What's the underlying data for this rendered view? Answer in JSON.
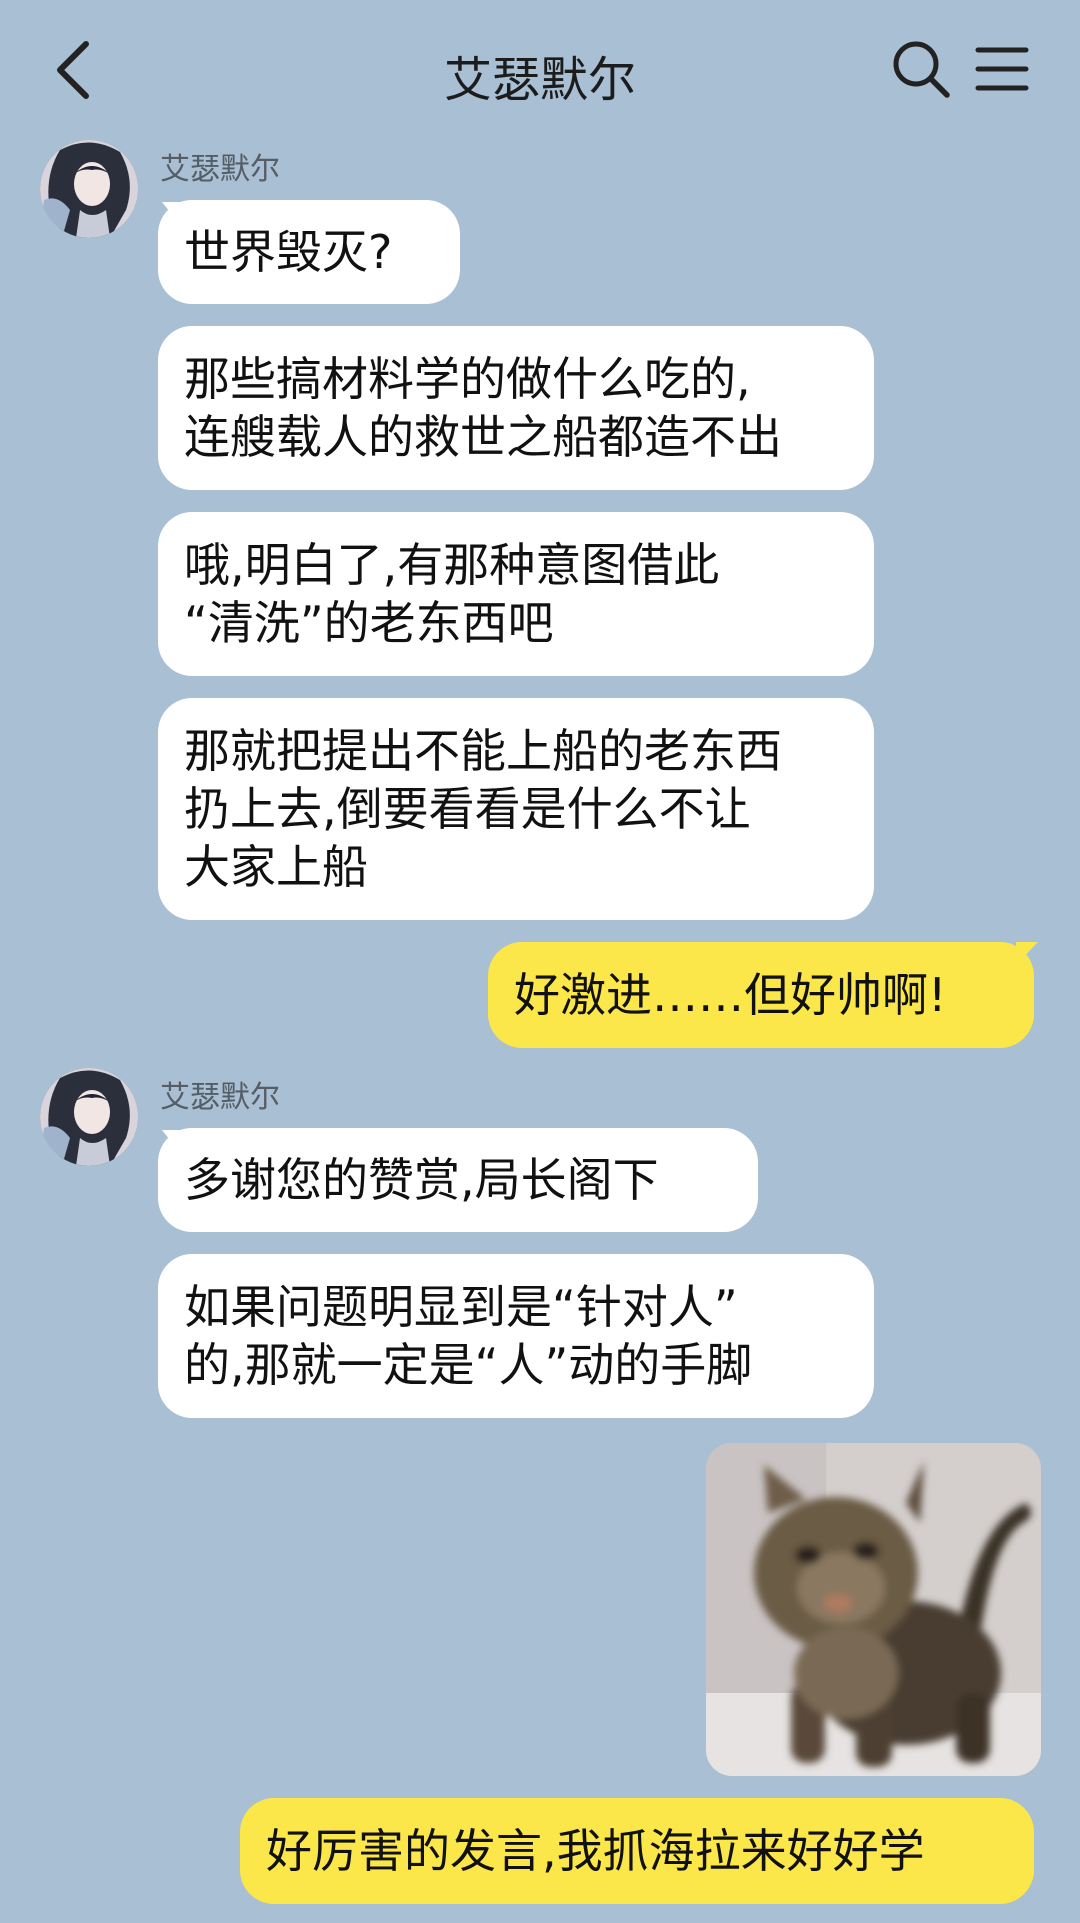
{
  "header": {
    "title": "艾瑟默尔",
    "back_icon": "chevron-left-icon",
    "search_icon": "search-icon",
    "menu_icon": "menu-icon"
  },
  "colors": {
    "background": "#a9bfd3",
    "incoming_bubble": "#ffffff",
    "outgoing_bubble": "#fbe74a"
  },
  "messages": {
    "group1": {
      "sender": "艾瑟默尔",
      "m1": [
        "世界毁灭?"
      ],
      "m2": [
        "那些搞材料学的做什么吃的,",
        "连艘载人的救世之船都造不出"
      ],
      "m3": [
        "哦,明白了,有那种意图借此",
        "“清洗”的老东西吧"
      ],
      "m4": [
        "那就把提出不能上船的老东西",
        "扔上去,倒要看看是什么不让",
        "大家上船"
      ]
    },
    "out1": "好激进……但好帅啊!",
    "group2": {
      "sender": "艾瑟默尔",
      "m1": [
        "多谢您的赞赏,局长阁下"
      ],
      "m2": [
        "如果问题明显到是“针对人”",
        "的,那就一定是“人”动的手脚"
      ]
    },
    "out_image": "cat sticker",
    "out2": "好厉害的发言,我抓海拉来好好学"
  }
}
